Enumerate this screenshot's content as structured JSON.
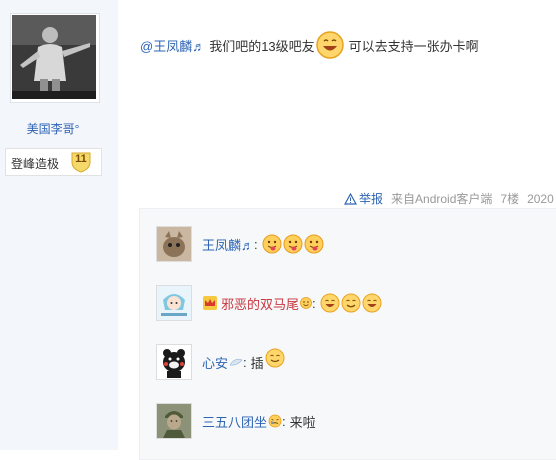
{
  "sidebar": {
    "username": "美国李哥°",
    "level_name": "登峰造极",
    "level_number": "11"
  },
  "post": {
    "mention": "@王凤麟♬",
    "text_before": "我们吧的13级吧友",
    "emoji": "grinning-face",
    "text_after": "可以去支持一张办卡啊"
  },
  "post_tail": {
    "report_label": "举报",
    "source": "来自Android客户端",
    "floor": "7楼",
    "date": "2020"
  },
  "replies": [
    {
      "name": "王凤麟♬",
      "separator": ":",
      "emojis": [
        "tongue-face",
        "tongue-face",
        "tongue-face"
      ]
    },
    {
      "name": "邪恶的双马尾",
      "separator": ":",
      "emojis": [
        "grinning-face",
        "smile-face",
        "grinning-face"
      ]
    },
    {
      "name": "心安",
      "separator": ":",
      "text": "插",
      "emojis": [
        "smirk-face"
      ]
    },
    {
      "name": "三五八团坐",
      "separator": ":",
      "text": "来啦",
      "emojis": []
    }
  ],
  "colors": {
    "link": "#2d64b3",
    "highlight_name": "#c8363f",
    "sidebar_bg": "#f3f6fb",
    "comment_bg": "#f7f8fa"
  }
}
